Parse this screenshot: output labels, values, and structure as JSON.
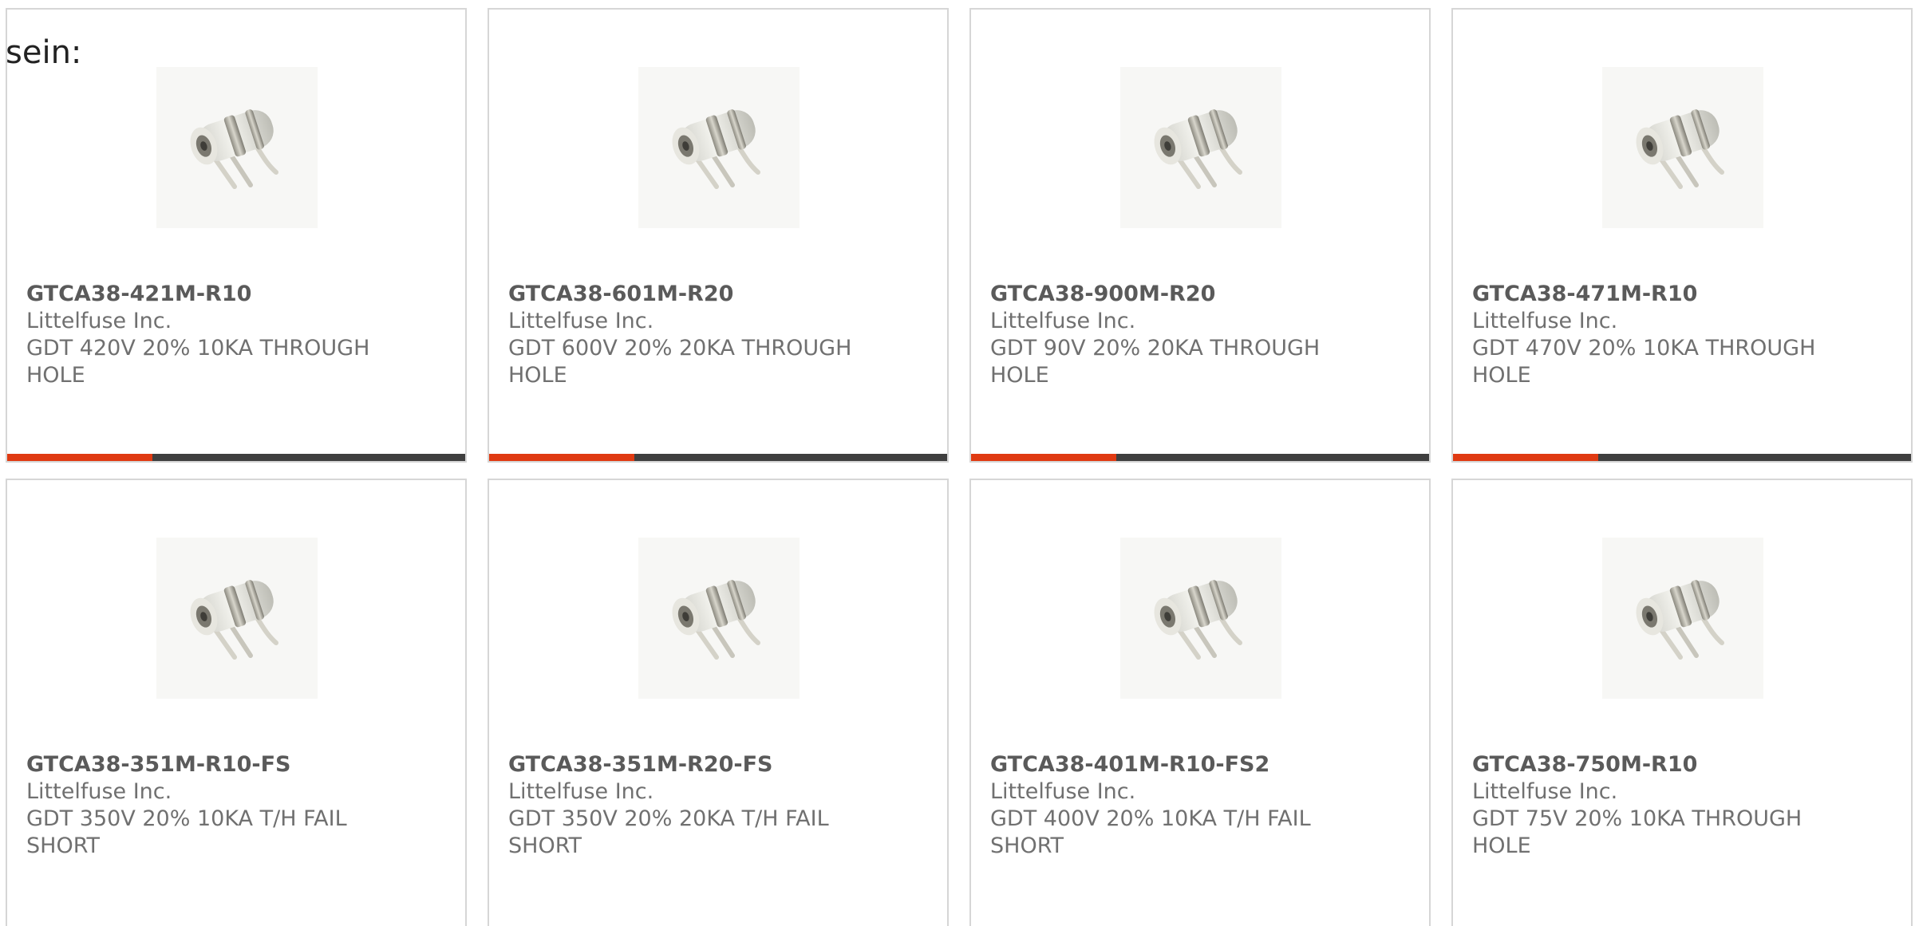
{
  "intro_text": "sein:",
  "accent_color": "#e03a12",
  "bar_color": "#3f3f3f",
  "products": [
    {
      "part_number": "GTCA38-421M-R10",
      "manufacturer": "Littelfuse Inc.",
      "description": "GDT 420V 20% 10KA THROUGH HOLE",
      "image": "gas-discharge-tube-icon"
    },
    {
      "part_number": "GTCA38-601M-R20",
      "manufacturer": "Littelfuse Inc.",
      "description": "GDT 600V 20% 20KA THROUGH HOLE",
      "image": "gas-discharge-tube-icon"
    },
    {
      "part_number": "GTCA38-900M-R20",
      "manufacturer": "Littelfuse Inc.",
      "description": "GDT 90V 20% 20KA THROUGH HOLE",
      "image": "gas-discharge-tube-icon"
    },
    {
      "part_number": "GTCA38-471M-R10",
      "manufacturer": "Littelfuse Inc.",
      "description": "GDT 470V 20% 10KA THROUGH HOLE",
      "image": "gas-discharge-tube-icon"
    },
    {
      "part_number": "GTCA38-351M-R10-FS",
      "manufacturer": "Littelfuse Inc.",
      "description": "GDT 350V 20% 10KA T/H FAIL SHORT",
      "image": "gas-discharge-tube-icon"
    },
    {
      "part_number": "GTCA38-351M-R20-FS",
      "manufacturer": "Littelfuse Inc.",
      "description": "GDT 350V 20% 20KA T/H FAIL SHORT",
      "image": "gas-discharge-tube-icon"
    },
    {
      "part_number": "GTCA38-401M-R10-FS2",
      "manufacturer": "Littelfuse Inc.",
      "description": "GDT 400V 20% 10KA T/H FAIL SHORT",
      "image": "gas-discharge-tube-icon"
    },
    {
      "part_number": "GTCA38-750M-R10",
      "manufacturer": "Littelfuse Inc.",
      "description": "GDT 75V 20% 10KA THROUGH HOLE",
      "image": "gas-discharge-tube-icon"
    }
  ]
}
